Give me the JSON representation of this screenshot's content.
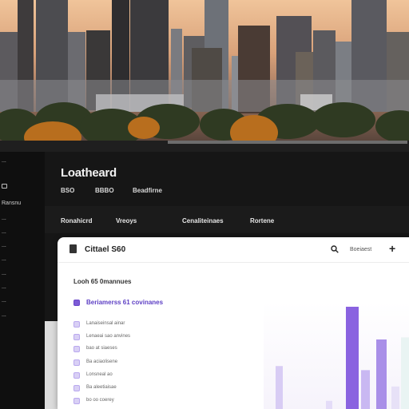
{
  "page": {
    "title": "Loatheard"
  },
  "meta": [
    {
      "text": "BSO"
    },
    {
      "text": "BBBO"
    },
    {
      "text": "Beadfirne"
    }
  ],
  "sidebar": {
    "items": [
      {
        "label": "..."
      },
      {
        "label": "Ransnu"
      },
      {
        "label": "..."
      },
      {
        "label": "..."
      },
      {
        "label": "..."
      },
      {
        "label": "..."
      },
      {
        "label": "..."
      },
      {
        "label": "..."
      },
      {
        "label": "..."
      },
      {
        "label": "..."
      }
    ]
  },
  "tabs": [
    {
      "label": "Ronahicrd"
    },
    {
      "label": "Vreoys"
    },
    {
      "label": "Cenaliteinaes"
    },
    {
      "label": "Rortene"
    }
  ],
  "card": {
    "title": "Cittael S60",
    "filter_label": "Boeiaest",
    "section_label": "Looh 65 0mannues",
    "rows": [
      {
        "label": "Beriamerss 61 covinanes",
        "checked": true
      },
      {
        "label": "Lanaiseinsal ainar"
      },
      {
        "label": "Lenaeai sao anvines"
      },
      {
        "label": "bao at siaeses"
      },
      {
        "label": "Ba aciaolisene"
      },
      {
        "label": "Lonsneal ao"
      },
      {
        "label": "Ba aleetiaisae"
      },
      {
        "label": "bo oo coerey"
      }
    ]
  },
  "chart_data": {
    "type": "bar",
    "categories": [
      "",
      "",
      "",
      "",
      "",
      "",
      ""
    ],
    "values": [
      42,
      8,
      100,
      38,
      68,
      22,
      70
    ],
    "ylim": [
      0,
      100
    ]
  },
  "colors": {
    "accent": "#7c5bd6",
    "accent_light": "#c9b8f2",
    "background": "#161616",
    "card": "#ffffff"
  }
}
